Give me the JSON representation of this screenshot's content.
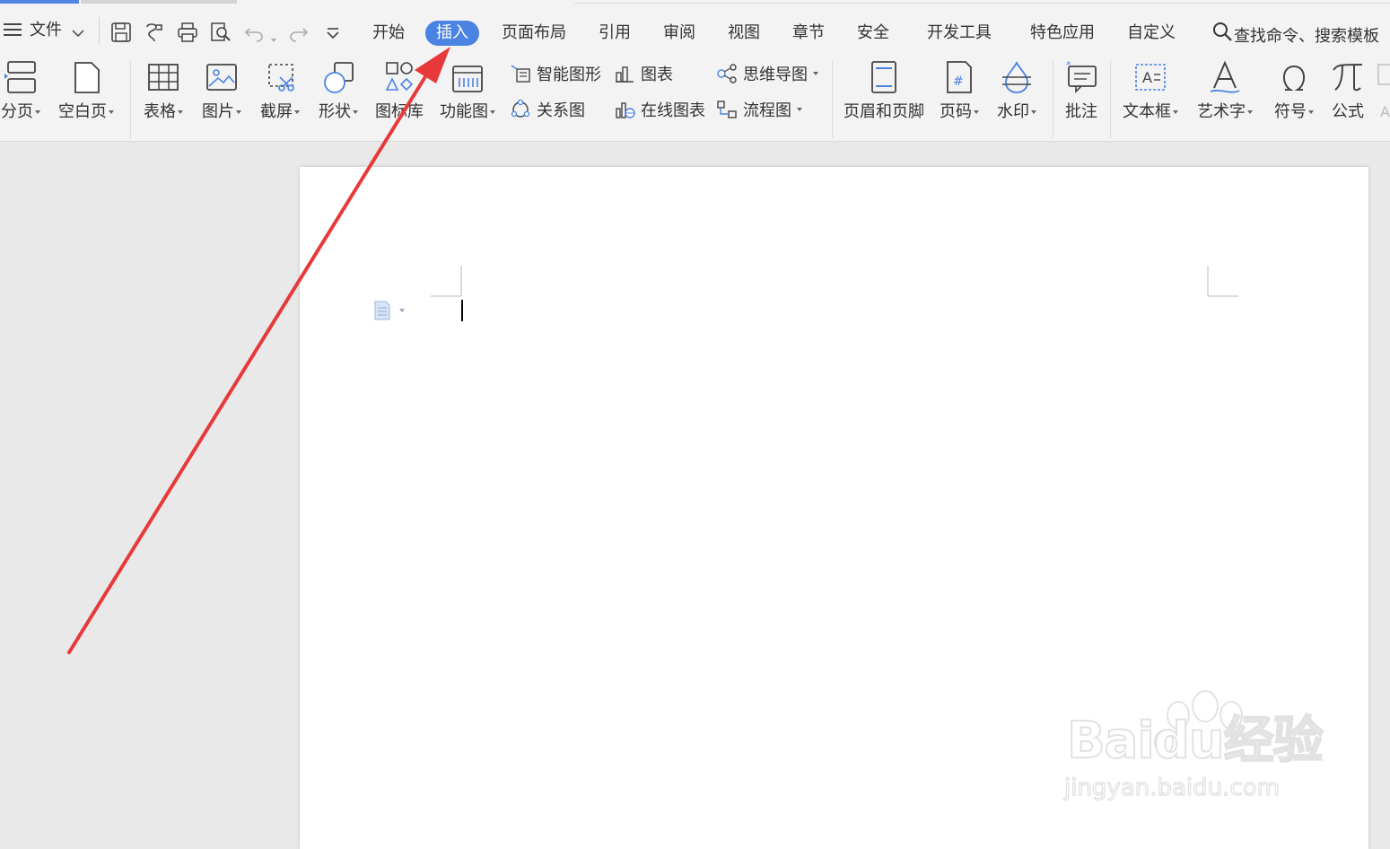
{
  "menubar": {
    "file_label": "文件",
    "tabs": [
      {
        "label": "开始",
        "active": false
      },
      {
        "label": "插入",
        "active": true
      },
      {
        "label": "页面布局",
        "active": false
      },
      {
        "label": "引用",
        "active": false
      },
      {
        "label": "审阅",
        "active": false
      },
      {
        "label": "视图",
        "active": false
      },
      {
        "label": "章节",
        "active": false
      },
      {
        "label": "安全",
        "active": false
      },
      {
        "label": "开发工具",
        "active": false
      },
      {
        "label": "特色应用",
        "active": false
      },
      {
        "label": "自定义",
        "active": false
      }
    ],
    "search_text": "查找命令、搜索模板"
  },
  "ribbon": {
    "page_break": "分页",
    "blank_page": "空白页",
    "table": "表格",
    "picture": "图片",
    "screenshot": "截屏",
    "shapes": "形状",
    "icon_library": "图标库",
    "function_chart": "功能图",
    "smart_art": "智能图形",
    "chart": "图表",
    "mind_map": "思维导图",
    "relation_chart": "关系图",
    "online_chart": "在线图表",
    "flowchart": "流程图",
    "header_footer": "页眉和页脚",
    "page_number": "页码",
    "watermark": "水印",
    "comment": "批注",
    "text_box": "文本框",
    "word_art": "艺术字",
    "symbol": "符号",
    "formula": "公式"
  },
  "watermark": {
    "brand": "Baidu经验",
    "url": "jingyan.baidu.com"
  },
  "colors": {
    "accent": "#4a83e2",
    "annotation_arrow": "#e8393a"
  }
}
